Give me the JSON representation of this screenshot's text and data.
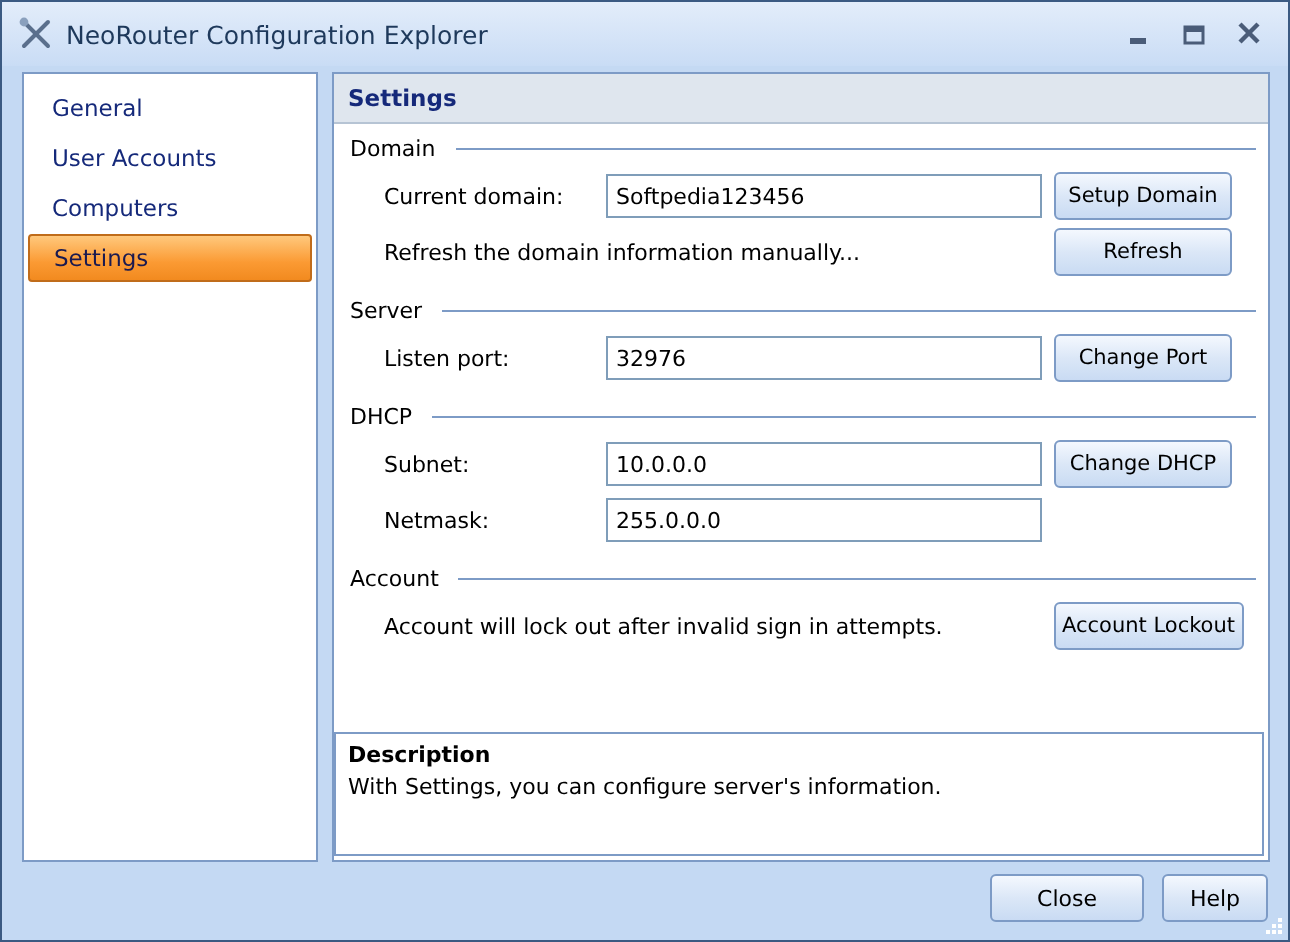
{
  "window": {
    "title": "NeoRouter Configuration Explorer"
  },
  "sidebar": {
    "items": [
      {
        "label": "General",
        "selected": false
      },
      {
        "label": "User Accounts",
        "selected": false
      },
      {
        "label": "Computers",
        "selected": false
      },
      {
        "label": "Settings",
        "selected": true
      }
    ]
  },
  "panel": {
    "title": "Settings",
    "sections": [
      {
        "title": "Domain",
        "rows": [
          {
            "kind": "field",
            "label": "Current domain:",
            "value": "Softpedia123456",
            "button": "Setup Domain"
          },
          {
            "kind": "text",
            "label": "Refresh the domain information manually...",
            "button": "Refresh"
          }
        ]
      },
      {
        "title": "Server",
        "rows": [
          {
            "kind": "field",
            "label": "Listen port:",
            "value": "32976",
            "button": "Change Port"
          }
        ]
      },
      {
        "title": "DHCP",
        "rows": [
          {
            "kind": "field",
            "label": "Subnet:",
            "value": "10.0.0.0",
            "button": "Change DHCP"
          },
          {
            "kind": "field",
            "label": "Netmask:",
            "value": "255.0.0.0"
          }
        ]
      },
      {
        "title": "Account",
        "rows": [
          {
            "kind": "text",
            "label": "Account will lock out after invalid sign in attempts.",
            "button": "Account Lockout"
          }
        ]
      }
    ]
  },
  "description": {
    "title": "Description",
    "text": "With Settings, you can configure server's information."
  },
  "buttons": [
    "Close",
    "Help"
  ]
}
